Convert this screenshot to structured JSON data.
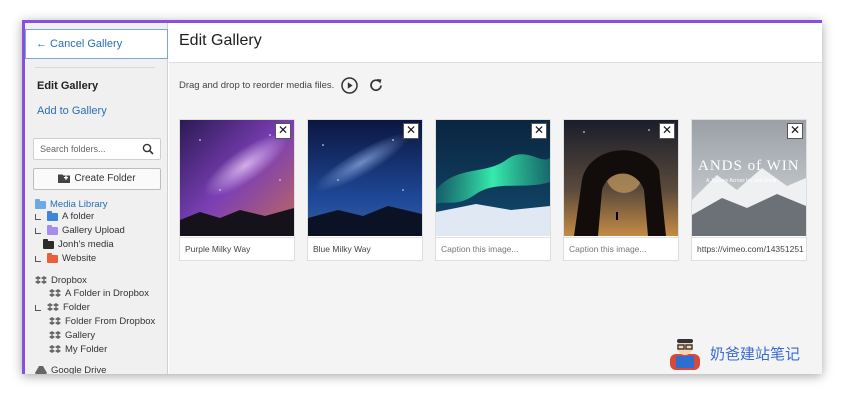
{
  "sidebar": {
    "cancel_label": "← Cancel Gallery",
    "edit_label": "Edit Gallery",
    "add_label": "Add to Gallery",
    "search_placeholder": "Search folders...",
    "create_label": "Create Folder",
    "tree": {
      "root": "Media Library",
      "items": [
        {
          "label": "A folder",
          "color": "#3d86d9"
        },
        {
          "label": "Gallery Upload",
          "color": "#a58cf0"
        },
        {
          "label": "Jonh's media",
          "color": "#2b2b2b"
        },
        {
          "label": "Website",
          "color": "#e8613a"
        }
      ],
      "dropbox_root": "Dropbox",
      "dropbox_items": [
        "A Folder in Dropbox",
        "Folder",
        "Folder From Dropbox",
        "Gallery",
        "My Folder"
      ],
      "google": "Google Drive"
    }
  },
  "main": {
    "title": "Edit Gallery",
    "hint": "Drag and drop to reorder media files."
  },
  "cards": [
    {
      "caption": "Purple Milky Way",
      "placeholder": false
    },
    {
      "caption": "Blue Milky Way",
      "placeholder": false
    },
    {
      "caption": "Caption this image...",
      "placeholder": true
    },
    {
      "caption": "Caption this image...",
      "placeholder": true
    },
    {
      "caption": "https://vimeo.com/14351251",
      "placeholder": false
    }
  ],
  "thumb5_text": {
    "line1": "ANDS of WIN",
    "line2": "A Journey Across Ice and Snow"
  },
  "watermark": "奶爸建站笔记",
  "colors": {
    "accent": "#8a4fe0",
    "link": "#2a6fb0"
  }
}
